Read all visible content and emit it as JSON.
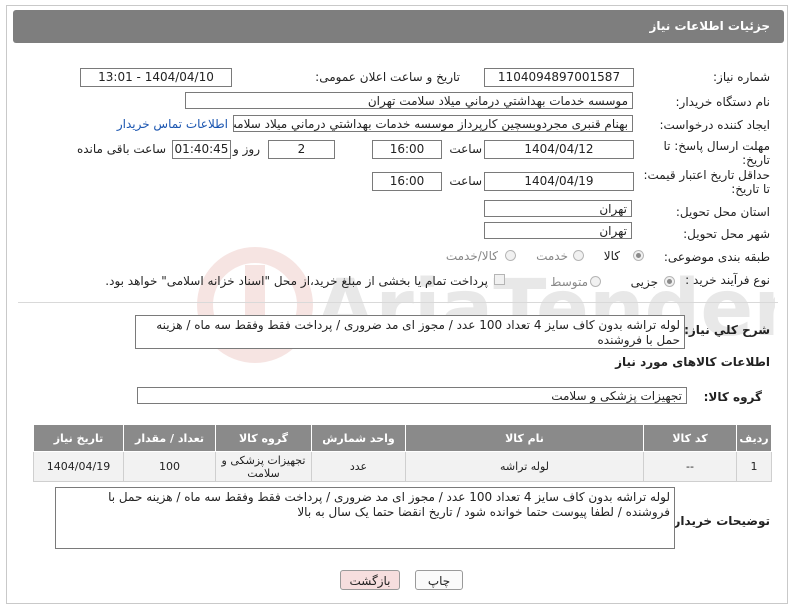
{
  "header": {
    "title": "جزئیات اطلاعات نیاز"
  },
  "labels": {
    "need_number": "شماره نیاز:",
    "announce_datetime": "تاریخ و ساعت اعلان عمومی:",
    "buyer_org": "نام دستگاه خریدار:",
    "requester": "ایجاد کننده درخواست:",
    "deadline_line1": "مهلت ارسال پاسخ: تا",
    "deadline_line2": "تاریخ:",
    "hour": "ساعت",
    "day_and": "روز و",
    "remaining": "ساعت باقی مانده",
    "price_validity_line1": "حداقل تاریخ اعتبار قیمت:",
    "price_validity_line2": "تا تاریخ:",
    "province": "استان محل تحویل:",
    "city": "شهر محل تحویل:",
    "category": "طبقه بندی موضوعی:",
    "purchase_type": "نوع فرآیند خرید :",
    "general_desc": "شرح کلي نياز:",
    "goods_info": "اطلاعات کالاهای مورد نیاز",
    "goods_group": "گروه کالا:",
    "buyer_notes": "توضیحات خریدار:"
  },
  "fields": {
    "need_number": "1104094897001587",
    "announce_datetime": "1404/04/10 - 13:01",
    "buyer_org": "موسسه خدمات بهداشتي درماني ميلاد سلامت تهران",
    "requester": "بهنام قنبری مجردوبسچین کارپرداز موسسه خدمات بهداشتي درماني ميلاد سلامت تهران",
    "contact_link": "اطلاعات تماس خریدار",
    "deadline_date": "1404/04/12",
    "deadline_time": "16:00",
    "days": "2",
    "remaining_time": "01:40:45",
    "validity_date": "1404/04/19",
    "validity_time": "16:00",
    "province": "تهران",
    "city": "تهران"
  },
  "category_options": {
    "goods": "کالا",
    "service": "خدمت",
    "goods_service": "کالا/خدمت"
  },
  "purchase_options": {
    "minor": "جزیی",
    "medium": "متوسط",
    "treasury_note": "پرداخت تمام یا بخشی از مبلغ خرید،از محل \"اسناد خزانه اسلامی\" خواهد بود."
  },
  "general_description": "لوله تراشه بدون کاف  سایز 4 تعداد 100 عدد / مجوز ای مد ضروری / پرداخت فقط وفقط سه ماه / هزینه حمل با فروشنده",
  "goods_group_value": "تجهیزات پزشکی و سلامت",
  "table": {
    "headers": [
      "ردیف",
      "کد کالا",
      "نام کالا",
      "واحد شمارش",
      "گروه کالا",
      "تعداد / مقدار",
      "تاریخ نیاز"
    ],
    "rows": [
      [
        "1",
        "--",
        "لوله تراشه",
        "عدد",
        "تجهیزات پزشکی و سلامت",
        "100",
        "1404/04/19"
      ]
    ]
  },
  "buyer_notes": "لوله تراشه بدون کاف  سایز 4 تعداد 100 عدد / مجوز ای مد ضروری / پرداخت فقط وفقط سه ماه / هزینه حمل با فروشنده / لطفا پیوست حتما خوانده شود / تاریخ انقضا حتما یک سال به بالا",
  "buttons": {
    "print": "چاپ",
    "back": "بازگشت"
  },
  "watermark": "AriaTender.neT"
}
